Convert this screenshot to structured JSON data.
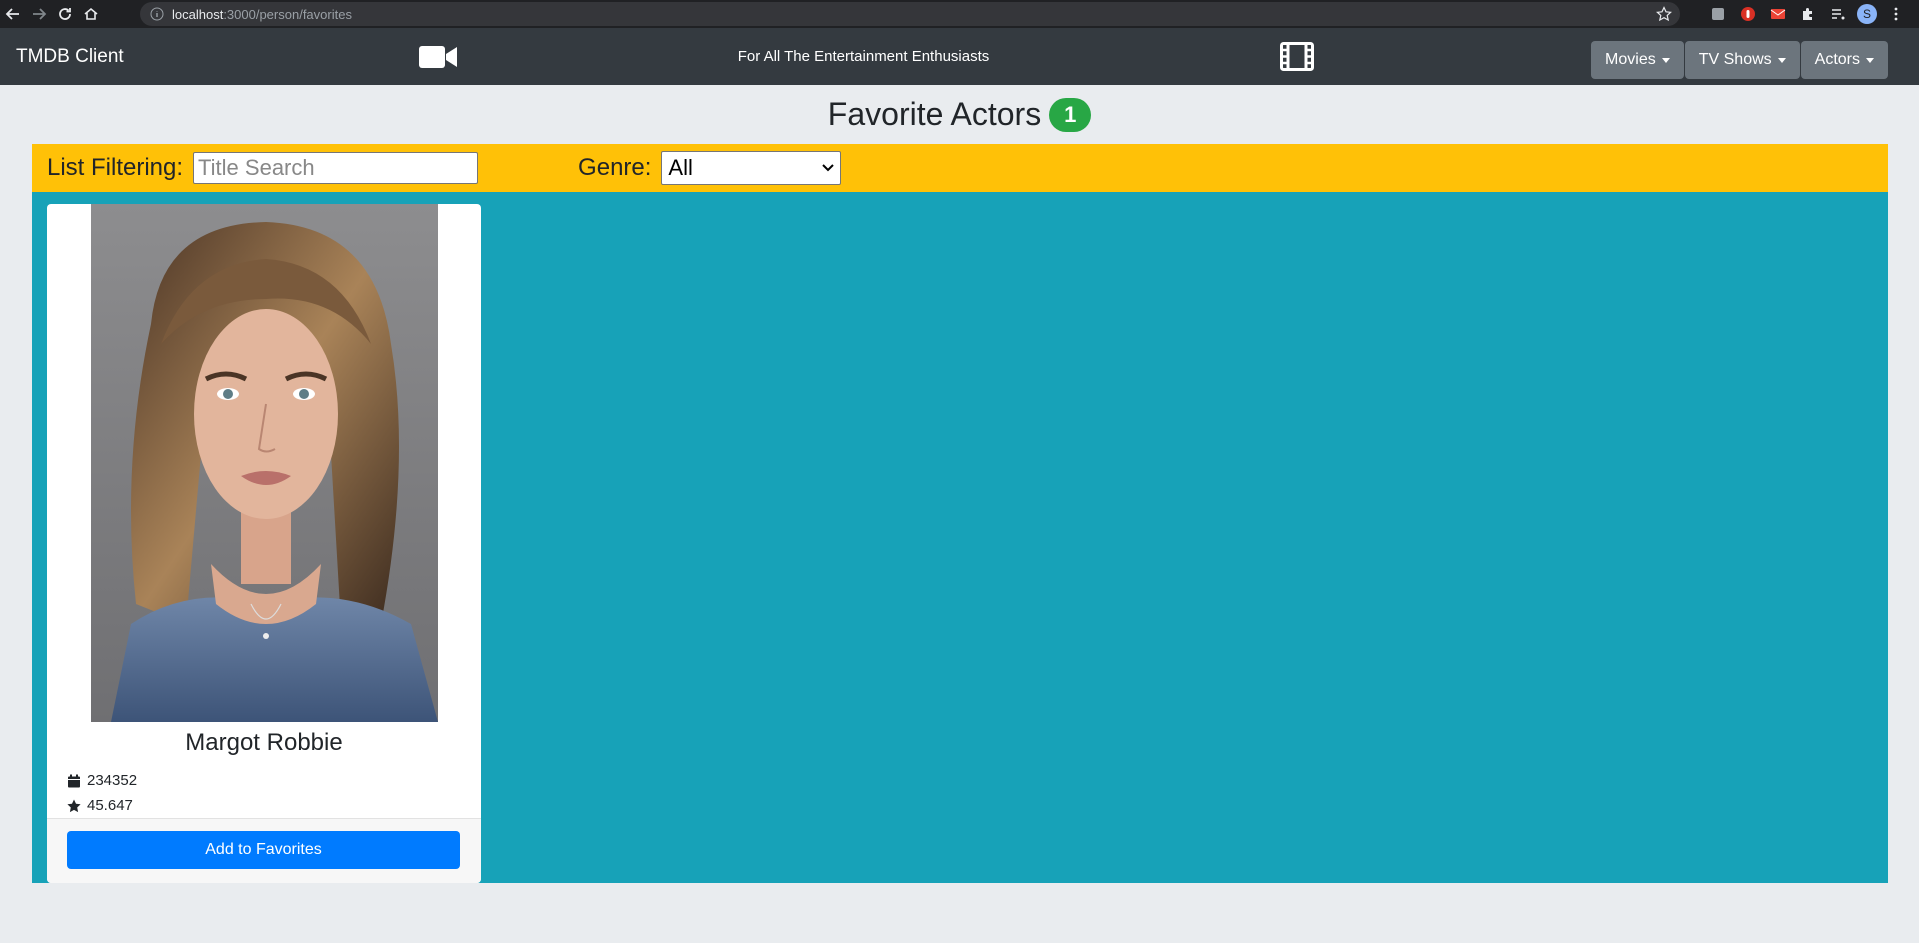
{
  "browser": {
    "url_host": "localhost",
    "url_path": ":3000/person/favorites",
    "profile_initial": "S"
  },
  "navbar": {
    "brand": "TMDB Client",
    "tagline": "For All The Entertainment Enthusiasts",
    "menus": [
      {
        "label": "Movies"
      },
      {
        "label": "TV Shows"
      },
      {
        "label": "Actors"
      }
    ]
  },
  "page": {
    "title": "Favorite Actors",
    "count": "1"
  },
  "filter": {
    "label": "List Filtering:",
    "search_placeholder": "Title Search",
    "genre_label": "Genre:",
    "genre_selected": "All"
  },
  "cards": [
    {
      "name": "Margot Robbie",
      "id_value": "234352",
      "popularity": "45.647",
      "button_label": "Add to Favorites"
    }
  ],
  "colors": {
    "navbar": "#343a40",
    "filter_bar": "#ffc107",
    "content_bg": "#17a2b8",
    "badge": "#28a745",
    "primary_button": "#007bff"
  }
}
